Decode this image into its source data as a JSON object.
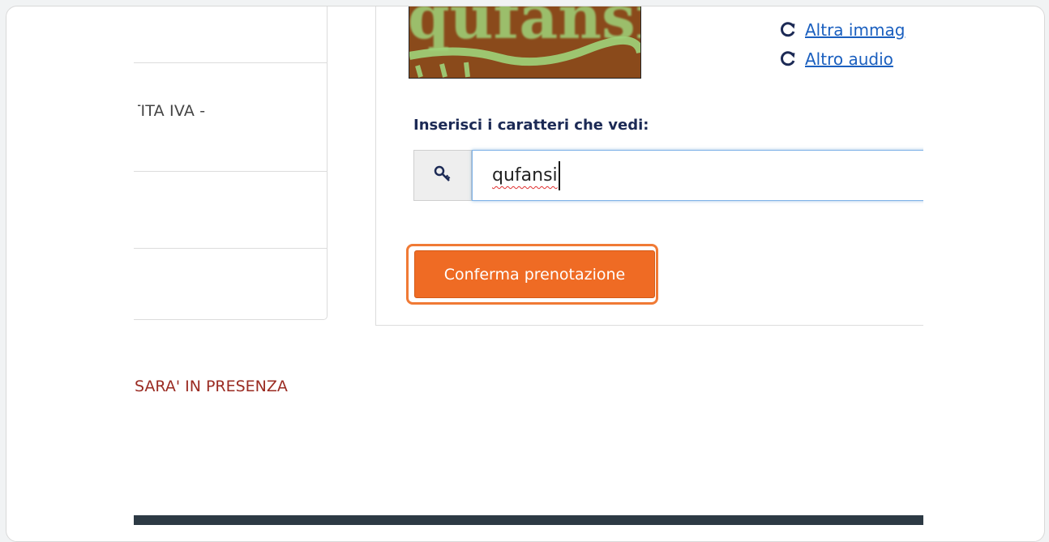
{
  "left_panel": {
    "partita_iva_text": "PARTITA IVA -"
  },
  "captcha": {
    "image_text": "qufansi",
    "refresh_image_label": "Altra immag",
    "refresh_audio_label": "Altro audio",
    "refresh_icon": "refresh-icon"
  },
  "form": {
    "field_label": "Inserisci i caratteri che vedi:",
    "key_icon": "key-icon",
    "input_value": "qufansi",
    "confirm_label": "Conferma prenotazione"
  },
  "notice": {
    "text": "O SARA' IN PRESENZA"
  },
  "colors": {
    "accent_orange": "#ef6b24",
    "label_navy": "#1c2a55",
    "link_blue": "#1a5fbf",
    "notice_red": "#9a2b22",
    "captcha_bg": "#8a4a1b",
    "captcha_text": "#9fd37a"
  }
}
